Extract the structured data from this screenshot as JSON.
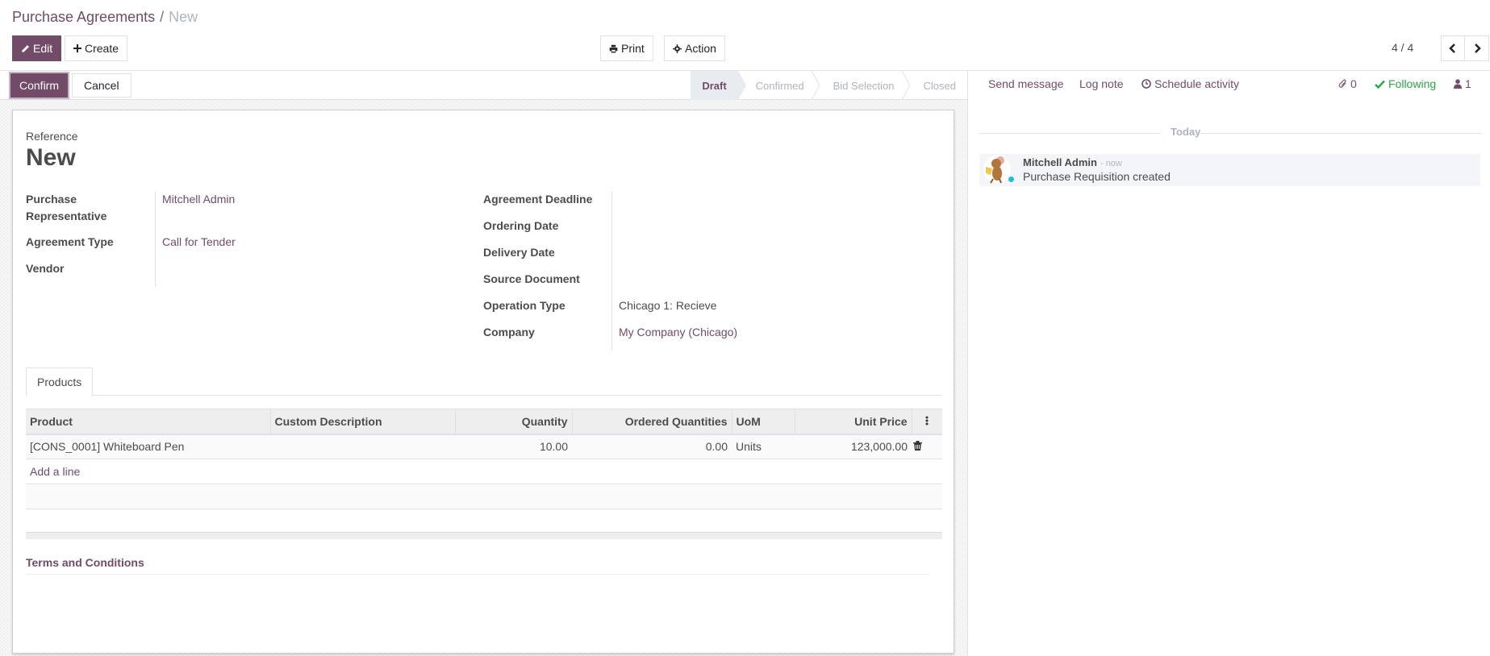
{
  "breadcrumb": {
    "parent": "Purchase Agreements",
    "separator": "/",
    "current": "New"
  },
  "toolbar": {
    "edit_label": "Edit",
    "create_label": "Create",
    "print_label": "Print",
    "action_label": "Action"
  },
  "pager": {
    "value": "4 / 4"
  },
  "statusbar": {
    "confirm_label": "Confirm",
    "cancel_label": "Cancel",
    "stages": [
      {
        "label": "Draft",
        "active": true
      },
      {
        "label": "Confirmed",
        "active": false
      },
      {
        "label": "Bid Selection",
        "active": false
      },
      {
        "label": "Closed",
        "active": false
      }
    ]
  },
  "form": {
    "reference_label": "Reference",
    "reference_value": "New",
    "left_fields": [
      {
        "label": "Purchase Representative",
        "value": "Mitchell Admin",
        "link": true
      },
      {
        "label": "Agreement Type",
        "value": "Call for Tender",
        "link": true
      },
      {
        "label": "Vendor",
        "value": "",
        "link": false
      }
    ],
    "right_fields": [
      {
        "label": "Agreement Deadline",
        "value": "",
        "link": false
      },
      {
        "label": "Ordering Date",
        "value": "",
        "link": false
      },
      {
        "label": "Delivery Date",
        "value": "",
        "link": false
      },
      {
        "label": "Source Document",
        "value": "",
        "link": false
      },
      {
        "label": "Operation Type",
        "value": "Chicago 1: Recieve",
        "link": false
      },
      {
        "label": "Company",
        "value": "My Company (Chicago)",
        "link": true
      }
    ],
    "tabs": [
      {
        "label": "Products",
        "active": true
      }
    ],
    "products_table": {
      "columns": [
        "Product",
        "Custom Description",
        "Quantity",
        "Ordered Quantities",
        "UoM",
        "Unit Price"
      ],
      "rows": [
        {
          "product": "[CONS_0001] Whiteboard Pen",
          "description": "",
          "quantity": "10.00",
          "ordered": "0.00",
          "uom": "Units",
          "unit_price": "123,000.00"
        }
      ],
      "add_line_label": "Add a line"
    },
    "terms_title": "Terms and Conditions"
  },
  "chatter": {
    "send_message": "Send message",
    "log_note": "Log note",
    "schedule_activity": "Schedule activity",
    "attachments_count": "0",
    "following_label": "Following",
    "followers_count": "1",
    "date_separator": "Today",
    "messages": [
      {
        "author": "Mitchell Admin",
        "time": "- now",
        "body": "Purchase Requisition created"
      }
    ]
  },
  "colors": {
    "brand": "#714B67",
    "following": "#28a745",
    "online": "#17c1d6"
  }
}
